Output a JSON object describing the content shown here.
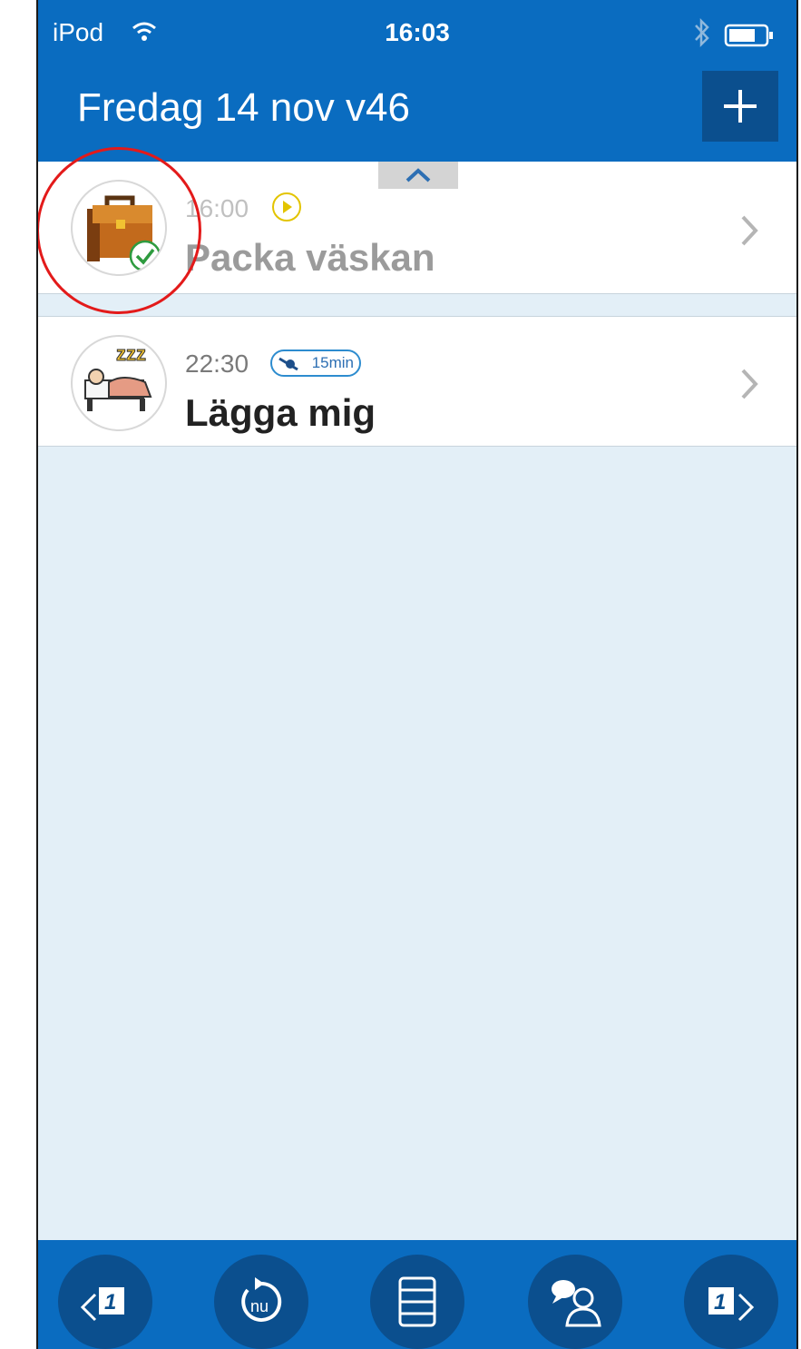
{
  "status_bar": {
    "carrier": "iPod",
    "time": "16:03",
    "icons": [
      "wifi-icon",
      "bluetooth-icon",
      "battery-icon"
    ]
  },
  "nav": {
    "title": "Fredag 14 nov v46",
    "add_icon": "plus-icon"
  },
  "activities": [
    {
      "time": "16:00",
      "name": "Packa väskan",
      "icon": "briefcase-icon",
      "status": "completed",
      "indicator": "bell-icon"
    },
    {
      "time": "22:30",
      "name": "Lägga mig",
      "icon": "sleeping-bed-icon",
      "indicator_label": "15min",
      "indicator": "timer-icon"
    }
  ],
  "tab_bar": [
    {
      "icon": "previous-day-icon",
      "label": "1"
    },
    {
      "icon": "now-icon",
      "label": "nu"
    },
    {
      "icon": "list-view-icon"
    },
    {
      "icon": "contacts-icon"
    },
    {
      "icon": "next-day-icon",
      "label": "1"
    }
  ],
  "colors": {
    "primary": "#0a6cc0",
    "tab_dark": "#0b4f8e",
    "background": "#e3eff7",
    "highlight": "#e31a1a",
    "check": "#2e9b3f"
  }
}
